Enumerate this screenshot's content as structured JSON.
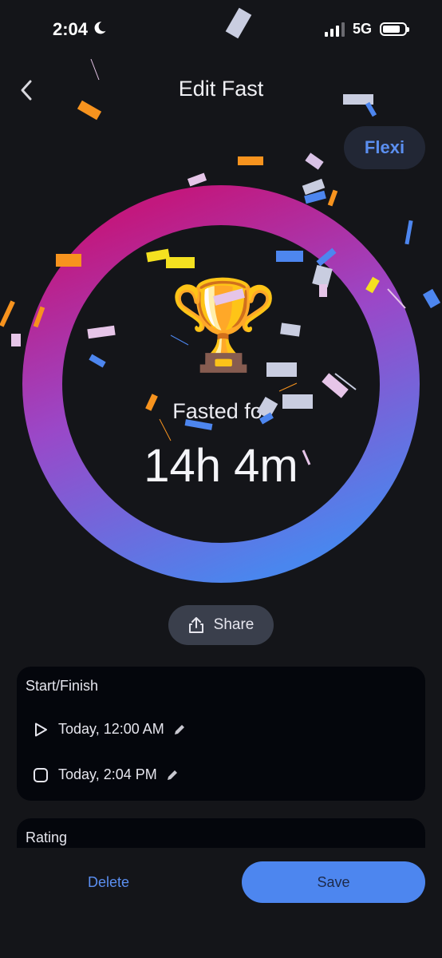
{
  "status_bar": {
    "time": "2:04",
    "network": "5G"
  },
  "header": {
    "title": "Edit Fast",
    "badge": "Flexi"
  },
  "summary": {
    "label": "Fasted for",
    "duration": "14h 4m"
  },
  "share": {
    "label": "Share"
  },
  "start_finish": {
    "title": "Start/Finish",
    "start": "Today, 12:00 AM",
    "finish": "Today, 2:04 PM"
  },
  "rating": {
    "title": "Rating"
  },
  "actions": {
    "delete": "Delete",
    "save": "Save"
  },
  "colors": {
    "background": "#141519",
    "accent": "#4d86ef",
    "ring_start": "#c2187e",
    "ring_end": "#4a86ee",
    "card": "#04060c"
  },
  "icons": {
    "back": "chevron-left-icon",
    "trophy": "trophy-icon",
    "share": "share-icon",
    "start": "play-icon",
    "finish": "stop-icon",
    "edit": "pencil-icon"
  }
}
